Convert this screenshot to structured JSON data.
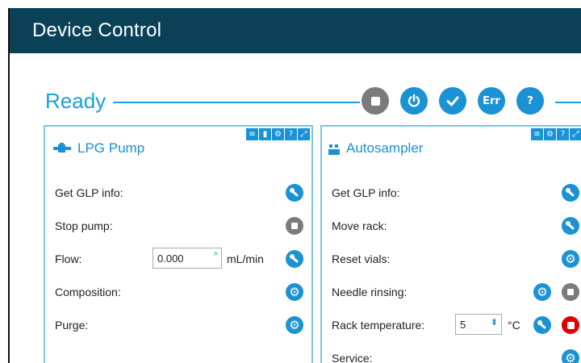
{
  "window": {
    "title": "Device Control"
  },
  "status": {
    "text": "Ready",
    "buttons": [
      {
        "name": "stop-icon",
        "kind": "stop"
      },
      {
        "name": "power-icon",
        "kind": "power"
      },
      {
        "name": "check-icon",
        "kind": "check"
      },
      {
        "name": "error-icon",
        "kind": "text",
        "label": "Err"
      },
      {
        "name": "help-icon",
        "kind": "text",
        "label": "?"
      }
    ]
  },
  "panels": {
    "lpg": {
      "title": "LPG Pump",
      "icon": "pump-icon",
      "tools": [
        "menu-icon",
        "lock-icon",
        "gear-icon",
        "help-icon",
        "expand-icon"
      ],
      "rows": {
        "glp": {
          "label": "Get GLP info:"
        },
        "stop": {
          "label": "Stop pump:"
        },
        "flow": {
          "label": "Flow:",
          "value": "0.000",
          "unit": "mL/min"
        },
        "composition": {
          "label": "Composition:"
        },
        "purge": {
          "label": "Purge:"
        }
      }
    },
    "autosampler": {
      "title": "Autosampler",
      "icon": "autosampler-icon",
      "tools": [
        "menu-icon",
        "gear-icon",
        "help-icon",
        "expand-icon"
      ],
      "rows": {
        "glp": {
          "label": "Get GLP info:"
        },
        "move": {
          "label": "Move rack:"
        },
        "reset": {
          "label": "Reset vials:"
        },
        "needle": {
          "label": "Needle rinsing:"
        },
        "temp": {
          "label": "Rack temperature:",
          "value": "5",
          "unit": "°C"
        },
        "service": {
          "label": "Service:"
        }
      }
    }
  },
  "colors": {
    "titlebar": "#0b4157",
    "accent": "#1a92d3",
    "status_line": "#1aa1d6",
    "stop_grey": "#7b7b7b",
    "alert_red": "#e00000"
  }
}
